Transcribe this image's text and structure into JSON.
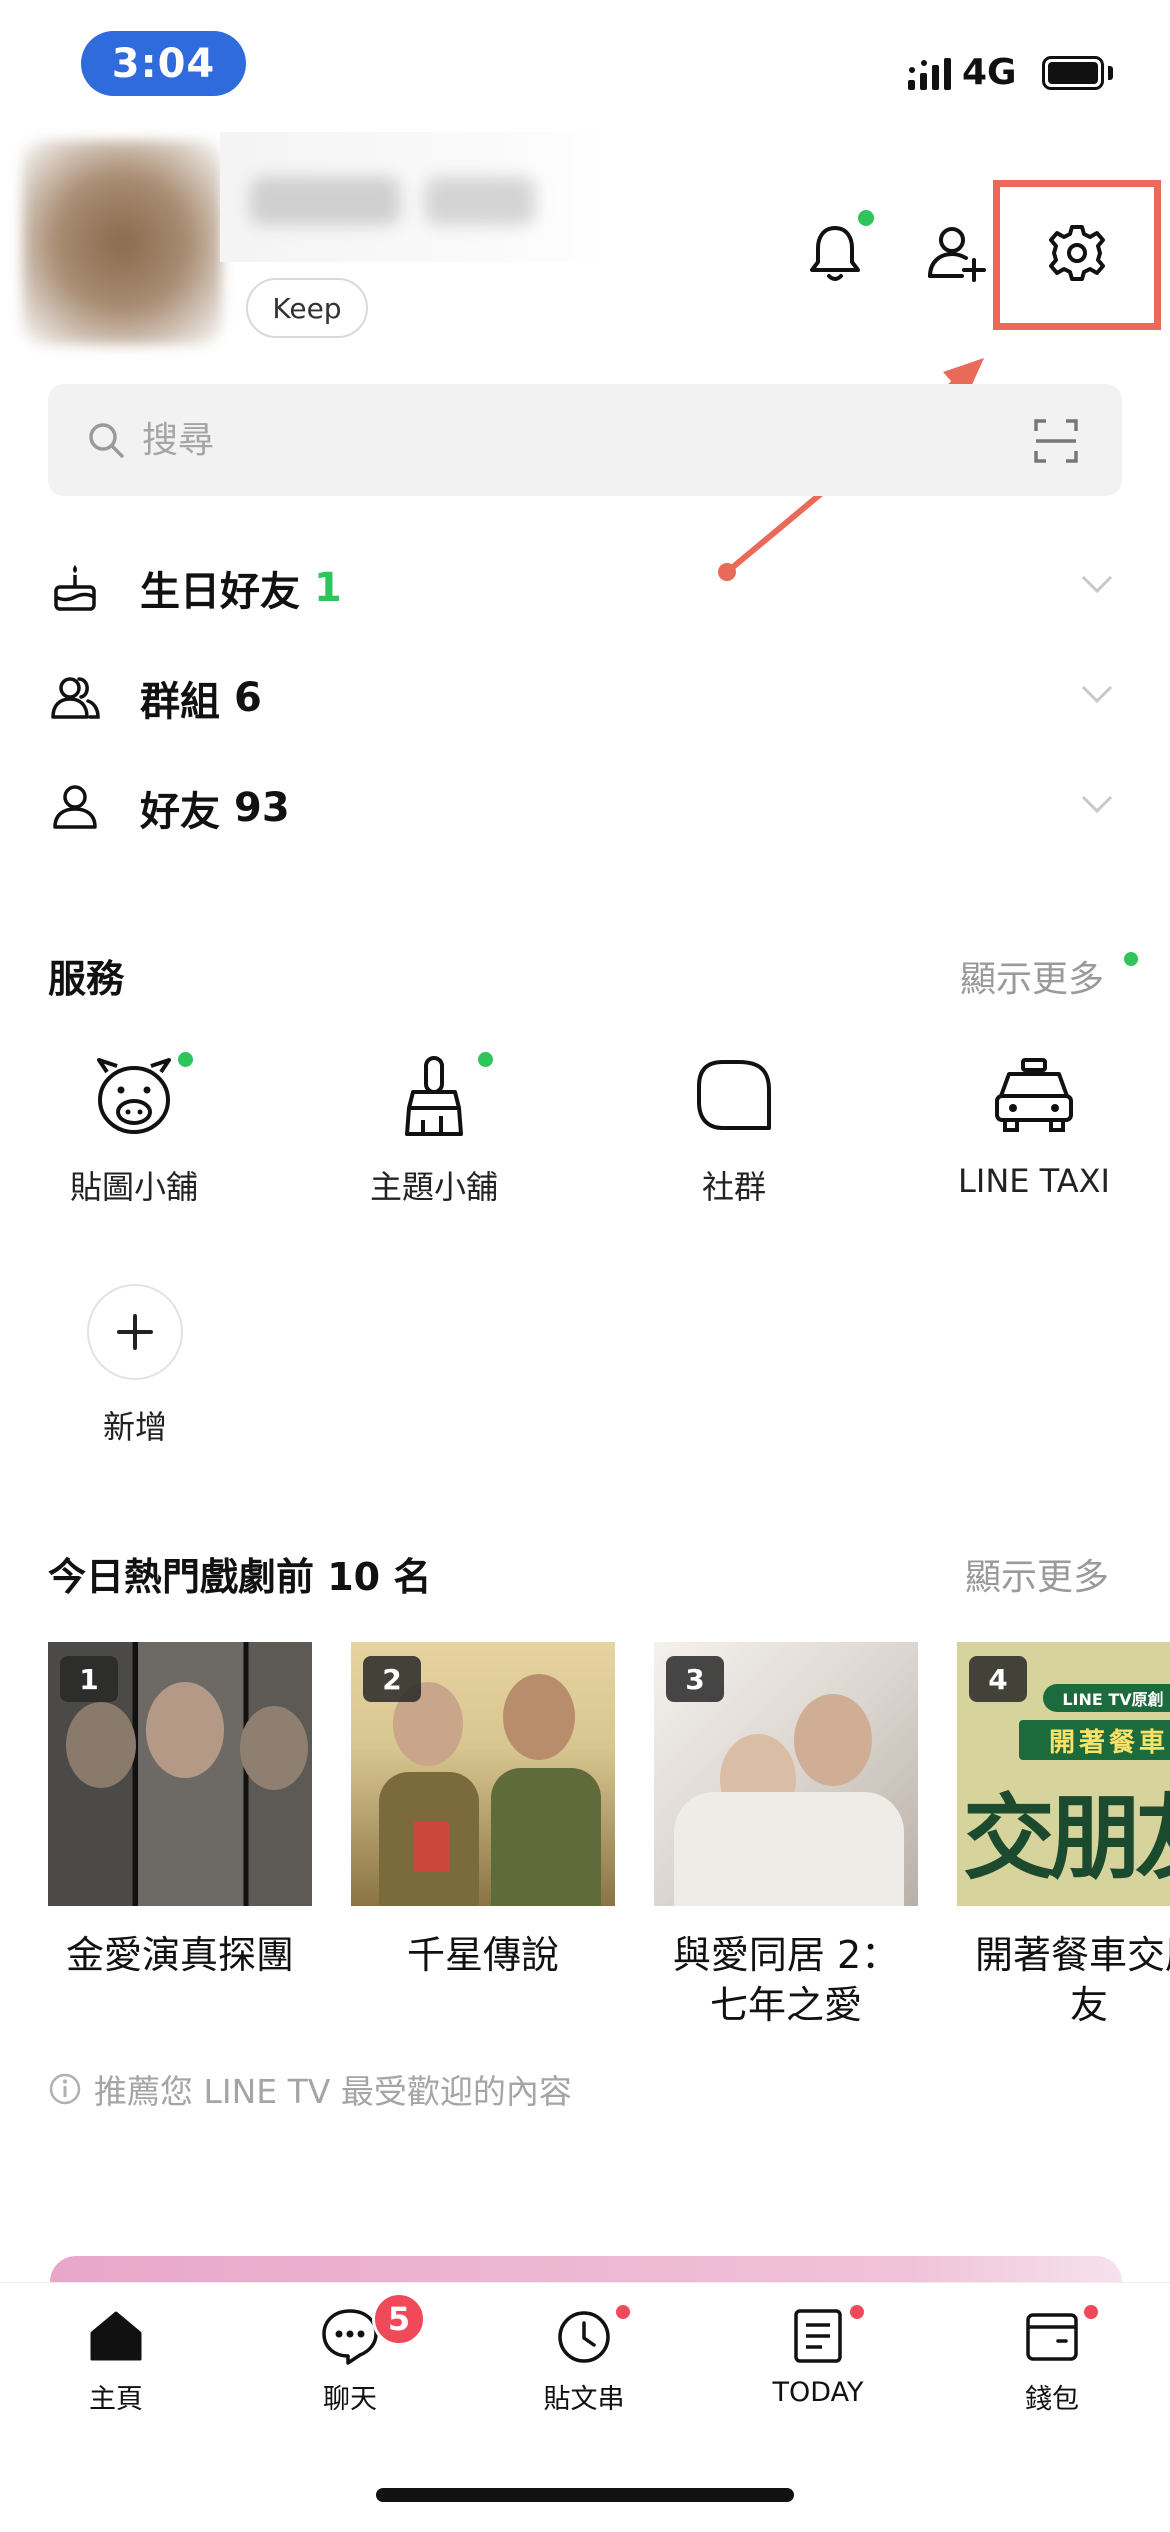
{
  "status_bar": {
    "time": "3:04",
    "network": "4G",
    "time_pill_color": "#2f6bdc"
  },
  "profile": {
    "keep_label": "Keep"
  },
  "header_icons": [
    "bell-icon",
    "add-friend-icon",
    "gear-icon"
  ],
  "search": {
    "placeholder": "搜尋"
  },
  "friend_sections": [
    {
      "label": "生日好友",
      "count": "1"
    },
    {
      "label": "群組",
      "count": "6"
    },
    {
      "label": "好友",
      "count": "93"
    }
  ],
  "services": {
    "title": "服務",
    "more": "顯示更多",
    "items": [
      {
        "label": "貼圖小舖",
        "icon": "sticker-shop-icon"
      },
      {
        "label": "主題小舖",
        "icon": "theme-shop-icon"
      },
      {
        "label": "社群",
        "icon": "openchat-icon"
      },
      {
        "label": "LINE TAXI",
        "icon": "taxi-icon"
      }
    ],
    "add_label": "新增"
  },
  "dramas": {
    "title": "今日熱門戲劇前 10 名",
    "more": "顯示更多",
    "items": [
      {
        "rank": "1",
        "title": "金愛演真探團"
      },
      {
        "rank": "2",
        "title": "千星傳說"
      },
      {
        "rank": "3",
        "title": "與愛同居 2：七年之愛"
      },
      {
        "rank": "4",
        "title": "開著餐車交朋友"
      }
    ],
    "poster4_brand": "LINE TV原創",
    "poster4_banner": "開著餐車",
    "poster4_big": "交朋友",
    "note": "推薦您 LINE TV 最受歡迎的內容"
  },
  "tabs": [
    {
      "label": "主頁",
      "icon": "home-icon"
    },
    {
      "label": "聊天",
      "icon": "chat-icon",
      "badge": "5"
    },
    {
      "label": "貼文串",
      "icon": "timeline-icon"
    },
    {
      "label": "TODAY",
      "icon": "today-icon"
    },
    {
      "label": "錢包",
      "icon": "wallet-icon"
    }
  ],
  "colors": {
    "line_green": "#2dc55c",
    "badge_red": "#f04a5a",
    "annotation_red": "#ea6a5a"
  }
}
